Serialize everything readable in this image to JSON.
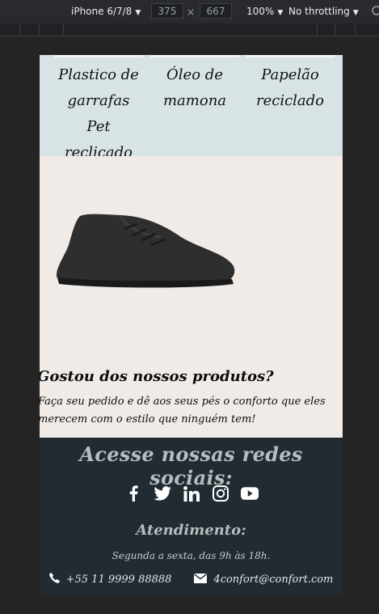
{
  "devtools": {
    "device": "iPhone 6/7/8",
    "width": "375",
    "times": "×",
    "height": "667",
    "zoom": "100%",
    "throttling": "No throttling"
  },
  "materials": [
    {
      "label": "Plastico de garrafas Pet reclicado"
    },
    {
      "label": "Óleo de mamona"
    },
    {
      "label": "Papelão reciclado"
    }
  ],
  "cta": {
    "title": "Gostou dos nossos produtos?",
    "text": "Faça seu pedido e dê aos seus pés o conforto que eles merecem com o estilo que ninguém tem!"
  },
  "footer": {
    "title": "Acesse nossas redes sociais:",
    "social_icons": [
      "facebook-icon",
      "twitter-icon",
      "linkedin-icon",
      "instagram-icon",
      "youtube-icon"
    ],
    "attendance_title": "Atendimento:",
    "hours": "Segunda a sexta, das 9h às 18h.",
    "phone": "+55 11 9999 88888",
    "email": "4confort@confort.com"
  },
  "colors": {
    "materials_bg": "#d8e3e6",
    "page_bg": "#f0ebe6",
    "footer_bg": "#212b31",
    "shoe": "#2e2e2e"
  }
}
